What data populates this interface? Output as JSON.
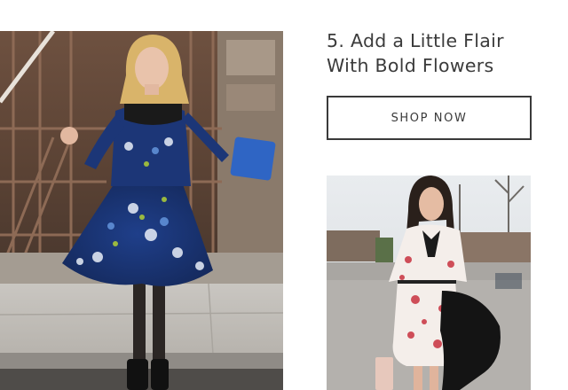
{
  "section": {
    "headline_line1": "5. Add a Little Flair",
    "headline_line2": "With Bold Flowers",
    "cta_label": "SHOP NOW"
  },
  "images": {
    "primary": "woman-in-navy-floral-dress-photo",
    "secondary": "woman-in-white-floral-dress-photo"
  },
  "colors": {
    "headline_text": "#3b3b3b",
    "button_border": "#3a3a3a",
    "background": "#ffffff"
  }
}
